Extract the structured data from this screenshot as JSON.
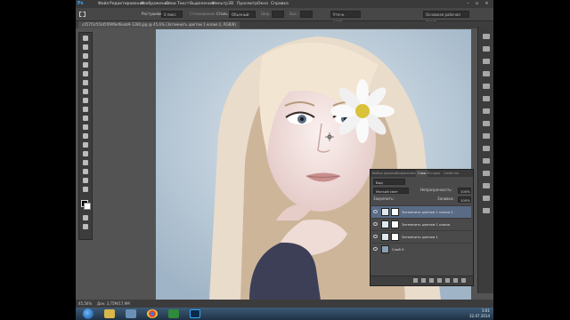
{
  "app": {
    "logo": "Ps"
  },
  "menu": [
    "Файл",
    "Редактирование",
    "Изображение",
    "Слои",
    "Текст",
    "Выделение",
    "Фильтр",
    "3D",
    "Просмотр",
    "Окно",
    "Справка"
  ],
  "window_controls": {
    "minimize": "–",
    "restore": "▫",
    "close": "×"
  },
  "options": {
    "feather_label": "Растушевка:",
    "feather_value": "0 пикс",
    "antialias": "Сглаживание",
    "style_label": "Стиль:",
    "style_value": "Обычный",
    "width_label": "Шир.:",
    "height_label": "Выс.:",
    "refine": "Уточн. край...",
    "workspace": "Основная рабочая среда"
  },
  "document_tab": {
    "label": "c457f3c5f3d5f09f6ef6eab9-1280.jpg @ 45,6% (Затемнить цветом 1 копия 2, RGB/8)"
  },
  "status": {
    "zoom": "45,56%",
    "doc": "Док: 3,75M/17,9M"
  },
  "layers_panel": {
    "tabs": [
      "Выбор ярлыков",
      "Содержимое",
      "Слои",
      "История",
      "Свойства"
    ],
    "active_tab": "Слои",
    "kind_label": "Вид",
    "blend_mode": "Мягкий свет",
    "opacity_label": "Непрозрачность:",
    "opacity_value": "100%",
    "lock_label": "Закрепить:",
    "fill_label": "Заливка:",
    "fill_value": "100%",
    "layers": [
      {
        "name": "Затемнить цветом 1 копия 2",
        "selected": true,
        "thumb": "#dfe7ee"
      },
      {
        "name": "Затемнить цветом 1 копия",
        "selected": false,
        "thumb": "#dfe7ee"
      },
      {
        "name": "Затемнить цветом 1",
        "selected": false,
        "thumb": "#dfe7ee"
      },
      {
        "name": "Слой 0",
        "selected": false,
        "thumb": "#8aa0b5"
      }
    ]
  },
  "taskbar": {
    "time": "3:01",
    "date": "22.07.2014"
  },
  "colors": {
    "accent": "#31a8ff",
    "panel": "#4a4a4a",
    "selected_layer": "#5a6b86"
  }
}
